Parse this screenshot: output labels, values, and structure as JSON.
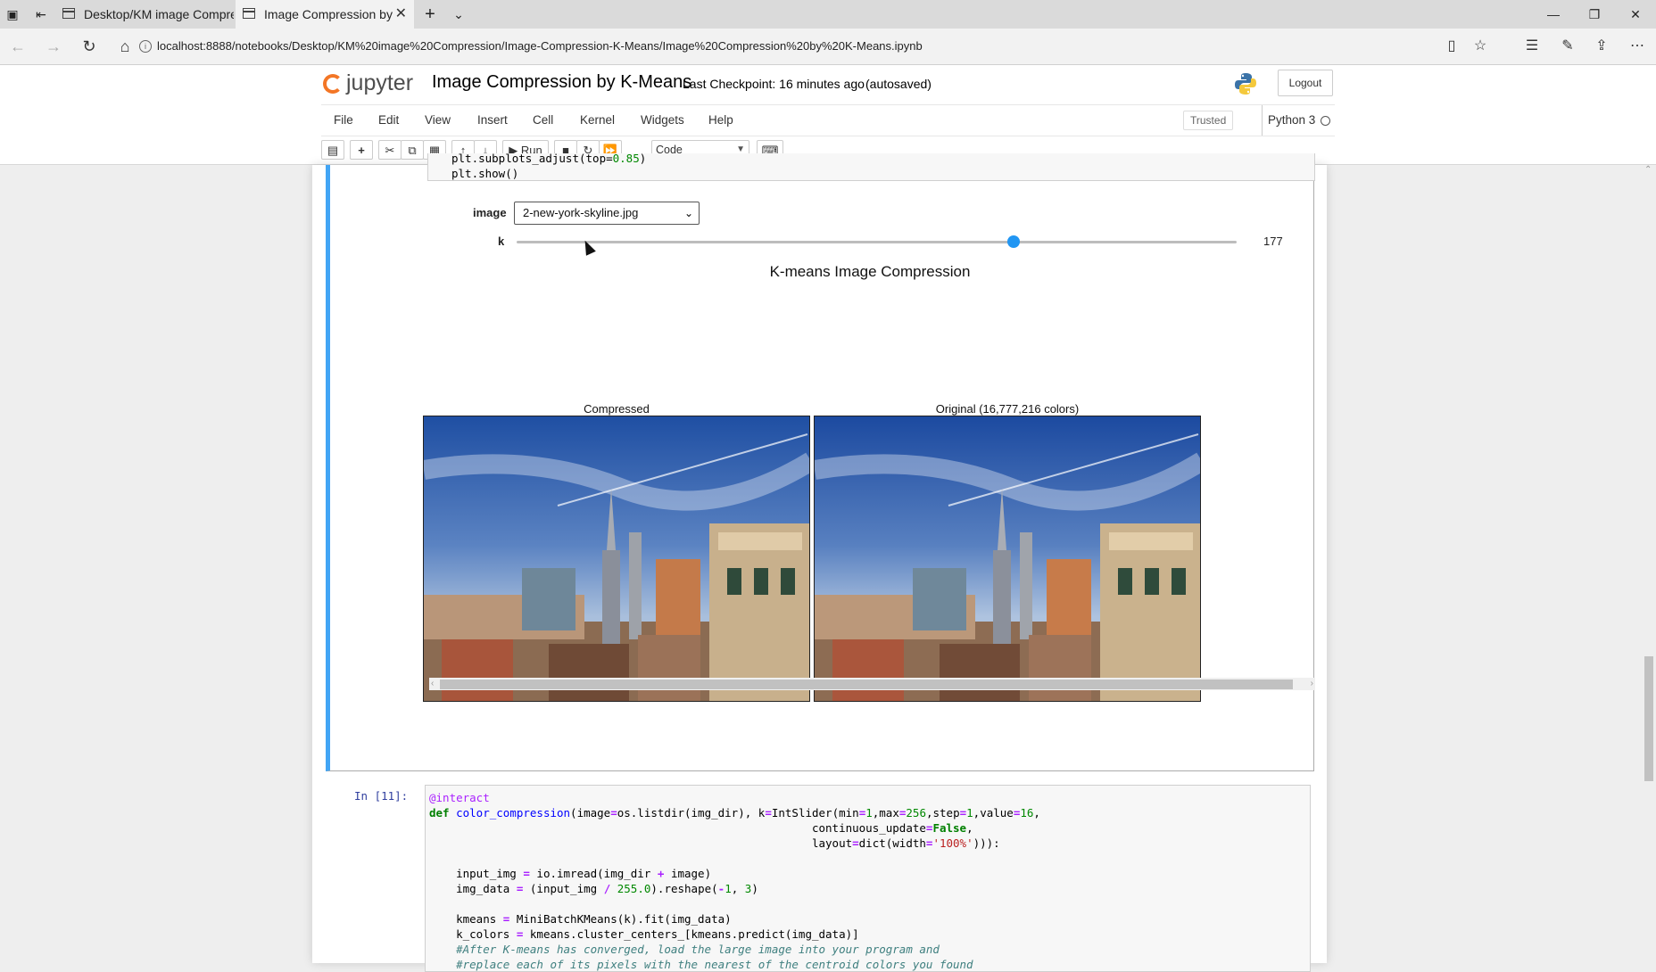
{
  "browser": {
    "tabs": [
      {
        "label": "Desktop/KM image Compre"
      },
      {
        "label": "Image Compression by",
        "close": "✕"
      }
    ],
    "url": "localhost:8888/notebooks/Desktop/KM%20image%20Compression/Image-Compression-K-Means/Image%20Compression%20by%20K-Means.ipynb"
  },
  "jupyter": {
    "logo": "jupyter",
    "notebook_title": "Image Compression by K-Means",
    "checkpoint": "Last Checkpoint: 16 minutes ago",
    "autosaved": "(autosaved)",
    "logout": "Logout",
    "menu": [
      "File",
      "Edit",
      "View",
      "Insert",
      "Cell",
      "Kernel",
      "Widgets",
      "Help"
    ],
    "trusted": "Trusted",
    "kernel": "Python 3",
    "toolbar": {
      "run": "Run",
      "cell_type": "Code"
    }
  },
  "cell1": {
    "code_lines": [
      "plt.subplots_adjust(top=0.85)",
      "plt.show()"
    ],
    "widget": {
      "image_label": "image",
      "image_value": "2-new-york-skyline.jpg",
      "k_label": "k",
      "k_value": "177",
      "k_min": 1,
      "k_max": 256
    },
    "figure_title": "K-means Image Compression",
    "left_title": "Compressed",
    "right_title": "Original (16,777,216 colors)"
  },
  "cell2": {
    "prompt": "In [11]:"
  },
  "colors": {
    "accent": "#42a5f5",
    "slider": "#2196f3",
    "orange": "#f37626"
  }
}
